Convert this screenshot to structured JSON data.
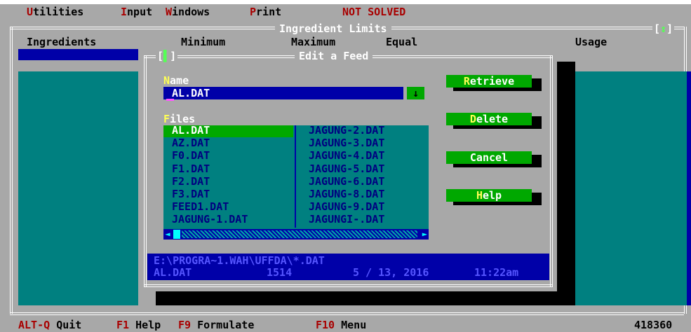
{
  "menu": {
    "utilities": "Utilities",
    "input": "Input",
    "windows": "Windows",
    "print": "Print",
    "status": "NOT SOLVED"
  },
  "main_window": {
    "title": "Ingredient Limits",
    "columns": [
      "Ingredients",
      "Minimum",
      "Maximum",
      "Equal",
      "Usage"
    ]
  },
  "dialog": {
    "title": "Edit a Feed",
    "name_label": "Name",
    "name_value": "AL.DAT",
    "files_label": "Files",
    "files_col1": [
      "AL.DAT",
      "AZ.DAT",
      "F0.DAT",
      "F1.DAT",
      "F2.DAT",
      "F3.DAT",
      "FEED1.DAT",
      "JAGUNG-1.DAT"
    ],
    "files_col2": [
      "JAGUNG-2.DAT",
      "JAGUNG-3.DAT",
      "JAGUNG-4.DAT",
      "JAGUNG-5.DAT",
      "JAGUNG-6.DAT",
      "JAGUNG-8.DAT",
      "JAGUNG-9.DAT",
      "JAGUNGI-.DAT"
    ],
    "selected_file": "AL.DAT",
    "path": "E:\\PROGRA~1.WAH\\UFFDA\\*.DAT",
    "info": {
      "file": "AL.DAT",
      "size": "1514",
      "date": "5 / 13, 2016",
      "time": "11:22am"
    },
    "buttons": {
      "retrieve": "Retrieve",
      "delete": "Delete",
      "cancel": "Cancel",
      "help": "Help"
    }
  },
  "statusbar": {
    "quit_key": "ALT-Q",
    "quit_label": "Quit",
    "help_key": "F1",
    "help_label": "Help",
    "formulate_key": "F9",
    "formulate_label": "Formulate",
    "menu_key": "F10",
    "menu_label": "Menu",
    "memory": "418360"
  }
}
